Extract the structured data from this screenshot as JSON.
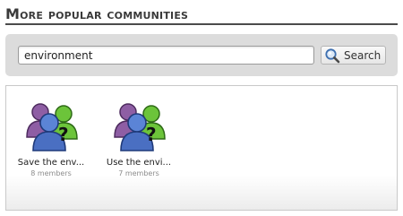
{
  "heading": "More popular communities",
  "search": {
    "value": "environment",
    "button_label": "Search",
    "icon": "magnifier-icon"
  },
  "communities": [
    {
      "name": "Save the env...",
      "members": "8 members",
      "icon": "community-group-icon"
    },
    {
      "name": "Use the envi...",
      "members": "7 members",
      "icon": "community-group-icon"
    }
  ],
  "colors": {
    "member_purple": "#8e5ea4",
    "member_green": "#6cc43a",
    "member_blue": "#4a6fc2",
    "panel_gray": "#dcdcdc"
  }
}
